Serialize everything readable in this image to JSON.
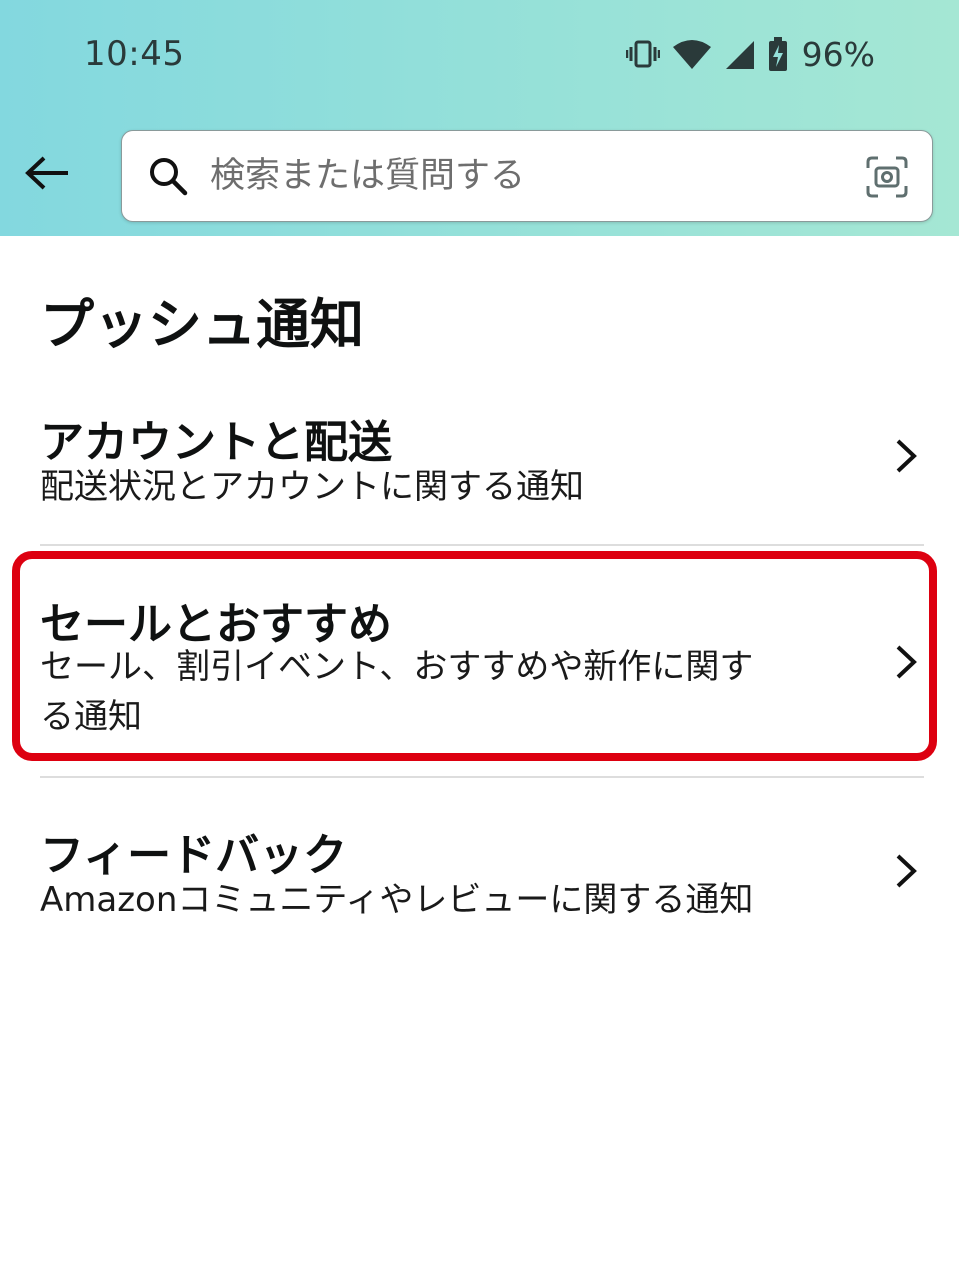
{
  "status_bar": {
    "time": "10:45",
    "battery_percent": "96%",
    "icons": [
      "vibrate-icon",
      "wifi-icon",
      "cell-signal-icon",
      "battery-charging-icon"
    ]
  },
  "header": {
    "back_icon": "arrow-left-icon",
    "search": {
      "placeholder": "検索または質問する",
      "value": "",
      "left_icon": "search-icon",
      "right_icon": "camera-scan-icon"
    }
  },
  "page": {
    "title": "プッシュ通知"
  },
  "items": [
    {
      "title": "アカウントと配送",
      "description": "配送状況とアカウントに関する通知"
    },
    {
      "title": "セールとおすすめ",
      "description_line1": "セール、割引イベント、おすすめや新作に関す",
      "description_line2": "る通知",
      "highlighted": true
    },
    {
      "title": "フィードバック",
      "description": "Amazonコミュニティやレビューに関する通知"
    }
  ],
  "colors": {
    "header_gradient_start": "#83d8df",
    "header_gradient_end": "#a5e7d4",
    "highlight_border": "#dd0010",
    "divider": "#dddddd"
  }
}
